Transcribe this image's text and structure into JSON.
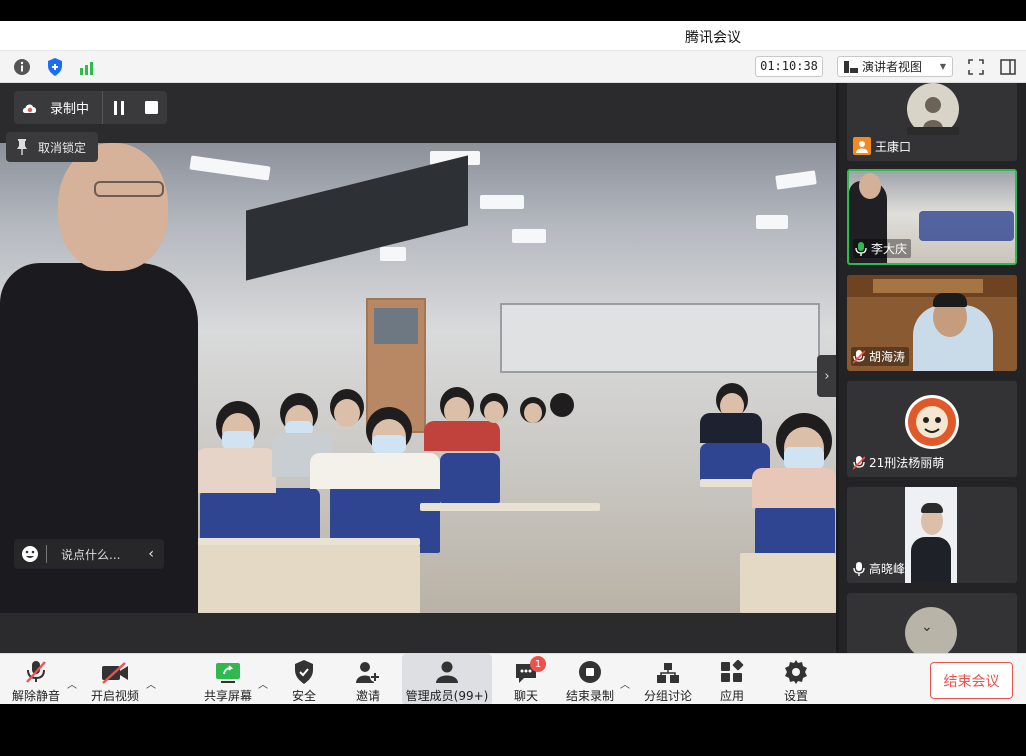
{
  "window": {
    "title": "腾讯会议"
  },
  "infobar": {
    "timer": "01:10:38",
    "view_select": "演讲者视图",
    "icons": [
      "info-icon",
      "shield-icon",
      "signal-icon",
      "fullscreen-icon",
      "sidebar-icon"
    ],
    "signal_color": "#2fb94f"
  },
  "main": {
    "recording_label": "录制中",
    "unpin_label": "取消锁定",
    "chat_placeholder": "说点什么..."
  },
  "participants": [
    {
      "name": "王康口",
      "mic": "avatar",
      "active": false
    },
    {
      "name": "李大庆",
      "mic": "on",
      "active": true
    },
    {
      "name": "胡海涛",
      "mic": "muted",
      "active": false
    },
    {
      "name": "21刑法杨丽萌",
      "mic": "muted",
      "active": false
    },
    {
      "name": "高晓峰",
      "mic": "on",
      "active": false
    }
  ],
  "toolbar": {
    "unmute": "解除静音",
    "start_video": "开启视频",
    "share_screen": "共享屏幕",
    "security": "安全",
    "invite": "邀请",
    "manage_members": "管理成员(99+)",
    "chat": "聊天",
    "chat_badge": "1",
    "end_recording": "结束录制",
    "breakout": "分组讨论",
    "apps": "应用",
    "settings": "设置",
    "end_meeting": "结束会议"
  },
  "colors": {
    "accent_green": "#2fb94f",
    "danger": "#e8544e",
    "brand_blue": "#1a6ef5"
  }
}
